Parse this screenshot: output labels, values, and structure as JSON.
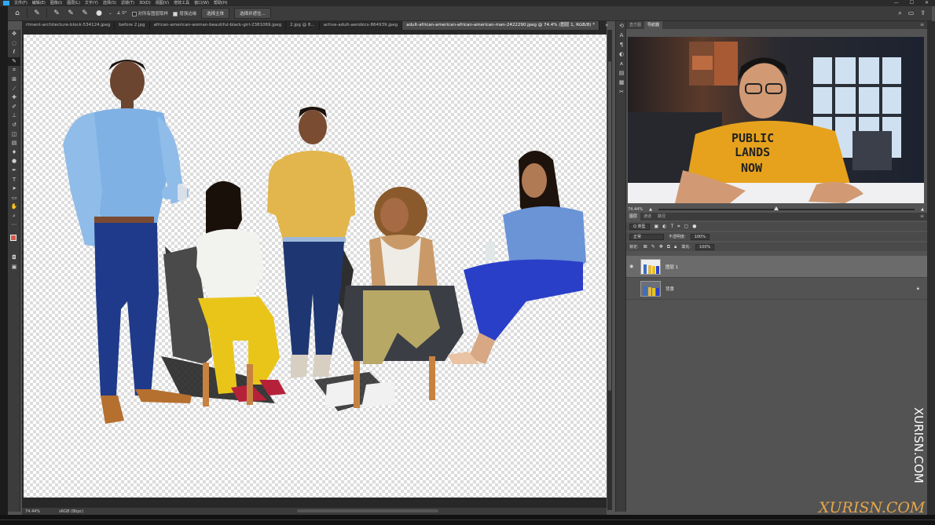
{
  "menubar": {
    "items": [
      "文件(F)",
      "编辑(E)",
      "图像(I)",
      "图层(L)",
      "文字(Y)",
      "选择(S)",
      "滤镜(T)",
      "3D(D)",
      "视图(V)",
      "增效工具",
      "窗口(W)",
      "帮助(H)"
    ]
  },
  "options": {
    "angle": "0°",
    "sample_all": "对所有图层取样",
    "enhance_edge": "增强边缘",
    "select_subject": "选择主体",
    "select_mask": "选择并遮住..."
  },
  "tabs": [
    "rtment-architecture-block-534124.jpeg",
    "before 2.jpg",
    "african-american-woman-beautiful-black-girl-2381069.jpeg",
    "2.jpg @ 8...",
    "active-adult-aerobics-864939.jpeg",
    "adult-african-american-african-american-man-2422290.jpeg @ 74.4% (图层 1, RGB/8) *"
  ],
  "status": {
    "zoom": "74.44%",
    "profile": "sRGB (8bpc)"
  },
  "navigator": {
    "tabs": [
      "直方图",
      "导航器"
    ],
    "zoom": "74.44%",
    "shirt_text": [
      "PUBLIC",
      "LANDS",
      "NOW"
    ]
  },
  "layers_panel": {
    "tabs": [
      "图层",
      "通道",
      "路径"
    ],
    "kind_filter": "Q 类型",
    "blend_mode": "正常",
    "opacity_label": "不透明度:",
    "opacity": "100%",
    "lock_label": "锁定:",
    "fill_label": "填充:",
    "fill": "100%",
    "layers": [
      {
        "name": "图层 1",
        "selected": true
      },
      {
        "name": "背景",
        "selected": false
      }
    ]
  },
  "watermark": {
    "vertical": "XURISN.COM",
    "bottom": "XURISN.COM"
  },
  "colors": {
    "foreground": "#d65a4a",
    "background": "#ffffff",
    "accent": "#31a8ff"
  }
}
